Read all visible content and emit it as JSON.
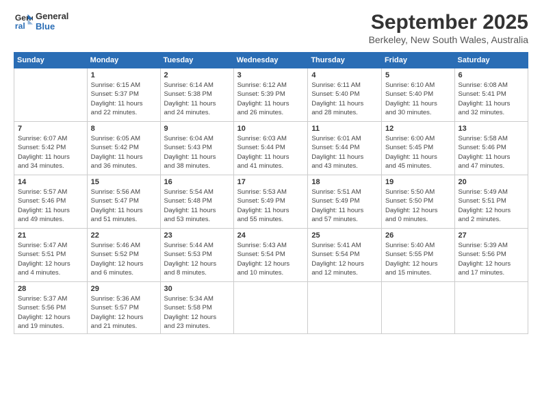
{
  "logo": {
    "line1": "General",
    "line2": "Blue"
  },
  "title": "September 2025",
  "location": "Berkeley, New South Wales, Australia",
  "weekdays": [
    "Sunday",
    "Monday",
    "Tuesday",
    "Wednesday",
    "Thursday",
    "Friday",
    "Saturday"
  ],
  "weeks": [
    [
      {
        "day": "",
        "info": ""
      },
      {
        "day": "1",
        "info": "Sunrise: 6:15 AM\nSunset: 5:37 PM\nDaylight: 11 hours\nand 22 minutes."
      },
      {
        "day": "2",
        "info": "Sunrise: 6:14 AM\nSunset: 5:38 PM\nDaylight: 11 hours\nand 24 minutes."
      },
      {
        "day": "3",
        "info": "Sunrise: 6:12 AM\nSunset: 5:39 PM\nDaylight: 11 hours\nand 26 minutes."
      },
      {
        "day": "4",
        "info": "Sunrise: 6:11 AM\nSunset: 5:40 PM\nDaylight: 11 hours\nand 28 minutes."
      },
      {
        "day": "5",
        "info": "Sunrise: 6:10 AM\nSunset: 5:40 PM\nDaylight: 11 hours\nand 30 minutes."
      },
      {
        "day": "6",
        "info": "Sunrise: 6:08 AM\nSunset: 5:41 PM\nDaylight: 11 hours\nand 32 minutes."
      }
    ],
    [
      {
        "day": "7",
        "info": "Sunrise: 6:07 AM\nSunset: 5:42 PM\nDaylight: 11 hours\nand 34 minutes."
      },
      {
        "day": "8",
        "info": "Sunrise: 6:05 AM\nSunset: 5:42 PM\nDaylight: 11 hours\nand 36 minutes."
      },
      {
        "day": "9",
        "info": "Sunrise: 6:04 AM\nSunset: 5:43 PM\nDaylight: 11 hours\nand 38 minutes."
      },
      {
        "day": "10",
        "info": "Sunrise: 6:03 AM\nSunset: 5:44 PM\nDaylight: 11 hours\nand 41 minutes."
      },
      {
        "day": "11",
        "info": "Sunrise: 6:01 AM\nSunset: 5:44 PM\nDaylight: 11 hours\nand 43 minutes."
      },
      {
        "day": "12",
        "info": "Sunrise: 6:00 AM\nSunset: 5:45 PM\nDaylight: 11 hours\nand 45 minutes."
      },
      {
        "day": "13",
        "info": "Sunrise: 5:58 AM\nSunset: 5:46 PM\nDaylight: 11 hours\nand 47 minutes."
      }
    ],
    [
      {
        "day": "14",
        "info": "Sunrise: 5:57 AM\nSunset: 5:46 PM\nDaylight: 11 hours\nand 49 minutes."
      },
      {
        "day": "15",
        "info": "Sunrise: 5:56 AM\nSunset: 5:47 PM\nDaylight: 11 hours\nand 51 minutes."
      },
      {
        "day": "16",
        "info": "Sunrise: 5:54 AM\nSunset: 5:48 PM\nDaylight: 11 hours\nand 53 minutes."
      },
      {
        "day": "17",
        "info": "Sunrise: 5:53 AM\nSunset: 5:49 PM\nDaylight: 11 hours\nand 55 minutes."
      },
      {
        "day": "18",
        "info": "Sunrise: 5:51 AM\nSunset: 5:49 PM\nDaylight: 11 hours\nand 57 minutes."
      },
      {
        "day": "19",
        "info": "Sunrise: 5:50 AM\nSunset: 5:50 PM\nDaylight: 12 hours\nand 0 minutes."
      },
      {
        "day": "20",
        "info": "Sunrise: 5:49 AM\nSunset: 5:51 PM\nDaylight: 12 hours\nand 2 minutes."
      }
    ],
    [
      {
        "day": "21",
        "info": "Sunrise: 5:47 AM\nSunset: 5:51 PM\nDaylight: 12 hours\nand 4 minutes."
      },
      {
        "day": "22",
        "info": "Sunrise: 5:46 AM\nSunset: 5:52 PM\nDaylight: 12 hours\nand 6 minutes."
      },
      {
        "day": "23",
        "info": "Sunrise: 5:44 AM\nSunset: 5:53 PM\nDaylight: 12 hours\nand 8 minutes."
      },
      {
        "day": "24",
        "info": "Sunrise: 5:43 AM\nSunset: 5:54 PM\nDaylight: 12 hours\nand 10 minutes."
      },
      {
        "day": "25",
        "info": "Sunrise: 5:41 AM\nSunset: 5:54 PM\nDaylight: 12 hours\nand 12 minutes."
      },
      {
        "day": "26",
        "info": "Sunrise: 5:40 AM\nSunset: 5:55 PM\nDaylight: 12 hours\nand 15 minutes."
      },
      {
        "day": "27",
        "info": "Sunrise: 5:39 AM\nSunset: 5:56 PM\nDaylight: 12 hours\nand 17 minutes."
      }
    ],
    [
      {
        "day": "28",
        "info": "Sunrise: 5:37 AM\nSunset: 5:56 PM\nDaylight: 12 hours\nand 19 minutes."
      },
      {
        "day": "29",
        "info": "Sunrise: 5:36 AM\nSunset: 5:57 PM\nDaylight: 12 hours\nand 21 minutes."
      },
      {
        "day": "30",
        "info": "Sunrise: 5:34 AM\nSunset: 5:58 PM\nDaylight: 12 hours\nand 23 minutes."
      },
      {
        "day": "",
        "info": ""
      },
      {
        "day": "",
        "info": ""
      },
      {
        "day": "",
        "info": ""
      },
      {
        "day": "",
        "info": ""
      }
    ]
  ]
}
